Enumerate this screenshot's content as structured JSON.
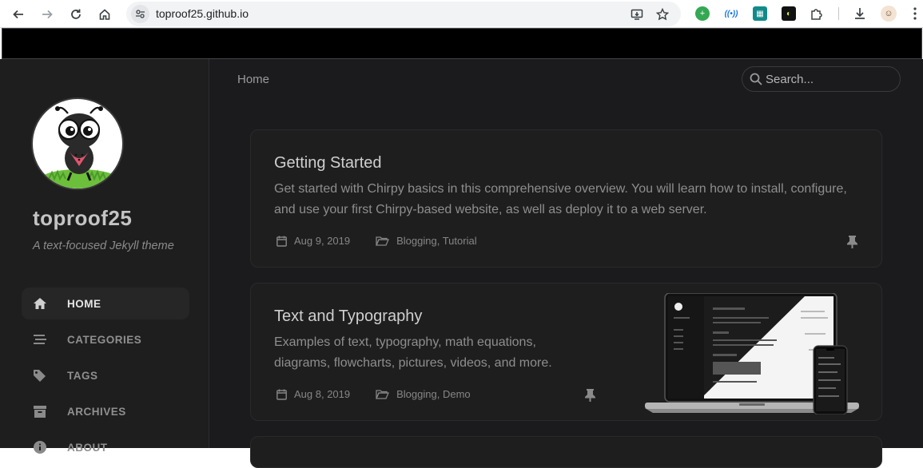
{
  "browser": {
    "url": "toproof25.github.io"
  },
  "sidebar": {
    "title": "toproof25",
    "subtitle": "A text-focused Jekyll theme",
    "nav": [
      {
        "label": "HOME",
        "icon": "home-icon",
        "active": true
      },
      {
        "label": "CATEGORIES",
        "icon": "stream-icon",
        "active": false
      },
      {
        "label": "TAGS",
        "icon": "tags-icon",
        "active": false
      },
      {
        "label": "ARCHIVES",
        "icon": "archive-icon",
        "active": false
      },
      {
        "label": "ABOUT",
        "icon": "info-icon",
        "active": false
      }
    ]
  },
  "topbar": {
    "breadcrumb": "Home",
    "search_placeholder": "Search..."
  },
  "posts": [
    {
      "title": "Getting Started",
      "description": "Get started with Chirpy basics in this comprehensive overview. You will learn how to install, configure, and use your first Chirpy-based website, as well as deploy it to a web server.",
      "date": "Aug 9, 2019",
      "categories": "Blogging, Tutorial",
      "pinned": true
    },
    {
      "title": "Text and Typography",
      "description": "Examples of text, typography, math equations, diagrams, flowcharts, pictures, videos, and more.",
      "date": "Aug 8, 2019",
      "categories": "Blogging, Demo",
      "pinned": true
    }
  ],
  "colors": {
    "background": "#1b1b1e",
    "sidebar": "#1e1e1e",
    "card": "#1e1e1e"
  }
}
